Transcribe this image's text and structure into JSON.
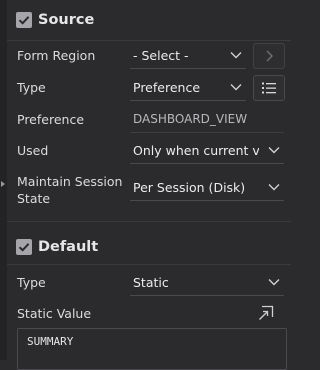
{
  "source": {
    "title": "Source",
    "fields": {
      "form_region": {
        "label": "Form Region",
        "value": "- Select -"
      },
      "type": {
        "label": "Type",
        "value": "Preference"
      },
      "preference": {
        "label": "Preference",
        "value": "DASHBOARD_VIEW"
      },
      "used": {
        "label": "Used",
        "value": "Only when current val"
      },
      "maintain_session_state": {
        "label_line1": "Maintain Session",
        "label_line2": "State",
        "value": "Per Session (Disk)"
      }
    }
  },
  "default": {
    "title": "Default",
    "fields": {
      "type": {
        "label": "Type",
        "value": "Static"
      },
      "static_value": {
        "label": "Static Value",
        "value": "SUMMARY"
      }
    }
  },
  "icons": {
    "collapse_source": "checkbox-checked-icon",
    "collapse_default": "checkbox-checked-icon",
    "go_to": "chevron-right-icon",
    "list": "list-icon",
    "expand": "expand-icon",
    "dropdown": "chevron-down-icon",
    "gutter": "caret-right-icon"
  },
  "colors": {
    "background": "#2b2b2d",
    "text": "#e3e3e5",
    "border": "#4a4a4e"
  }
}
